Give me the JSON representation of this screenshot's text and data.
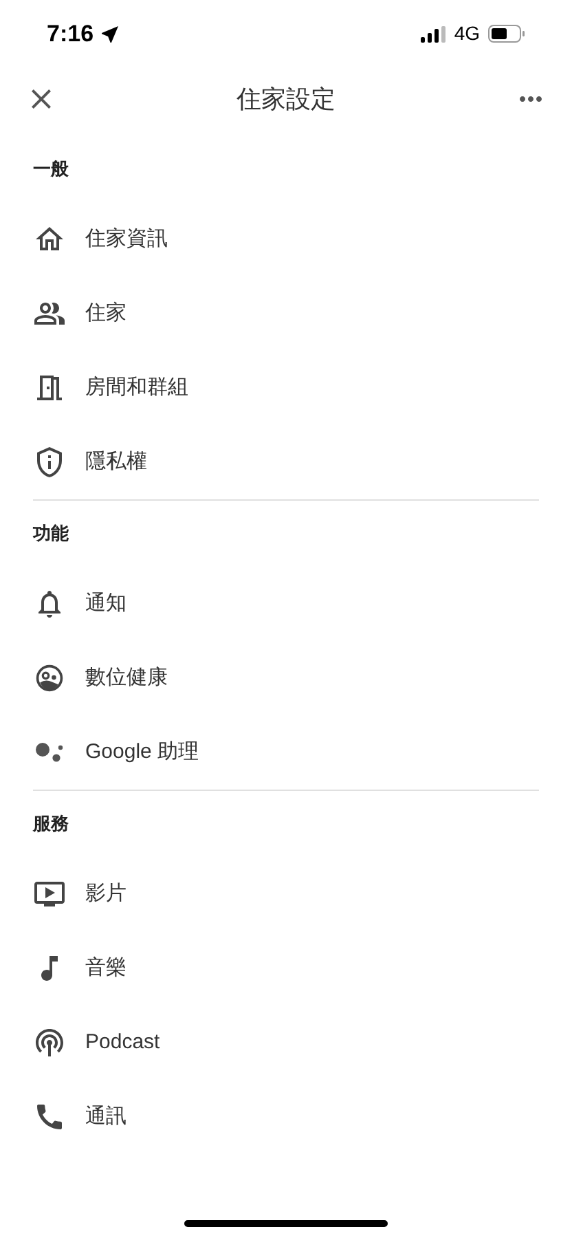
{
  "status_bar": {
    "time": "7:16",
    "network": "4G"
  },
  "header": {
    "title": "住家設定"
  },
  "sections": [
    {
      "title": "一般",
      "items": [
        {
          "label": "住家資訊",
          "kind": "home"
        },
        {
          "label": "住家",
          "kind": "people"
        },
        {
          "label": "房間和群組",
          "kind": "room"
        },
        {
          "label": "隱私權",
          "kind": "privacy"
        }
      ]
    },
    {
      "title": "功能",
      "items": [
        {
          "label": "通知",
          "kind": "bell"
        },
        {
          "label": "數位健康",
          "kind": "wellbeing"
        },
        {
          "label": "Google 助理",
          "kind": "assistant"
        }
      ]
    },
    {
      "title": "服務",
      "items": [
        {
          "label": "影片",
          "kind": "video"
        },
        {
          "label": "音樂",
          "kind": "music"
        },
        {
          "label": "Podcast",
          "kind": "podcast"
        },
        {
          "label": "通訊",
          "kind": "phone"
        }
      ]
    }
  ]
}
